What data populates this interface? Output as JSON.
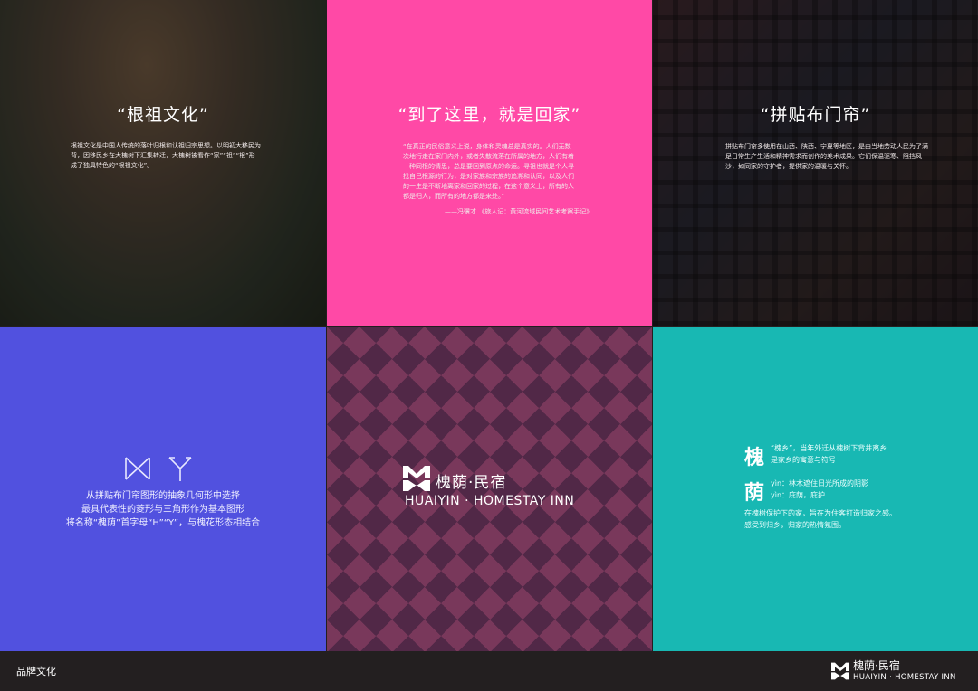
{
  "panel_culture": {
    "title": "“根祖文化”",
    "body": "根祖文化是中国人传统的落叶归根和认祖归宗思想。以明初大移民为背，因移民乡在大槐树下汇集转迁，大槐树被看作“家”“祖”“根”形成了独具特色的“根祖文化”。"
  },
  "panel_home": {
    "title": "“到了这里，就是回家”",
    "body": "“在真正的民俗意义上说，身体和灵魂总是真实的。人们无数次地行走在家门内外，或者失散流落在所属的地方，人们有着一种同根的情思，总是要回到原点的命运。寻祖也就是个人寻找自己根源的行为，是对家族和宗族的追溯和认同，以及人们的一生是不断地离家和回家的过程，在这个意义上，所有的人都是归人，而所有的地方都是来处。”",
    "source": "——冯骥才 《旅人记：黄河流域民间艺术考察手记》"
  },
  "panel_patchwork": {
    "title": "“拼贴布门帘”",
    "body": "拼贴布门帘多使用在山西、陕西、宁夏等地区，是由当地劳动人民为了满足日常生产生活和精神需求而创作的美术成果。它们保温驱寒、阻挡风沙，如同家的守护者，提供家的温暖与关怀。"
  },
  "panel_logo_concept": {
    "slogan_lines": [
      "从拼贴布门帘图形的抽象几何形中选择",
      "最具代表性的菱形与三角形作为基本图形",
      "将名称“槐荫”首字母“H”“Y”，与槐花形态相结合"
    ]
  },
  "brand": {
    "name_cn": "槐荫·民宿",
    "name_en": "HUAIYIN · HOMESTAY INN"
  },
  "panel_meaning": {
    "char1": "槐",
    "char1_lines": [
      "“槐乡”，当年外迁从槐树下背井离乡",
      "是家乡的寓意与符号"
    ],
    "char2": "荫",
    "char2_lines": [
      "yìn：林木遮住日光所成的阴影",
      "yìn：庇荫，庇护"
    ],
    "closing_lines": [
      "在槐树保护下的家，旨在为住客打造归家之感。",
      "感受到归乡，归家的热情氛围。"
    ]
  },
  "footer": {
    "label": "品牌文化"
  },
  "colors": {
    "pink": "#ff49a6",
    "violet": "#5151df",
    "teal": "#18b8b3",
    "dark": "#231f20"
  }
}
